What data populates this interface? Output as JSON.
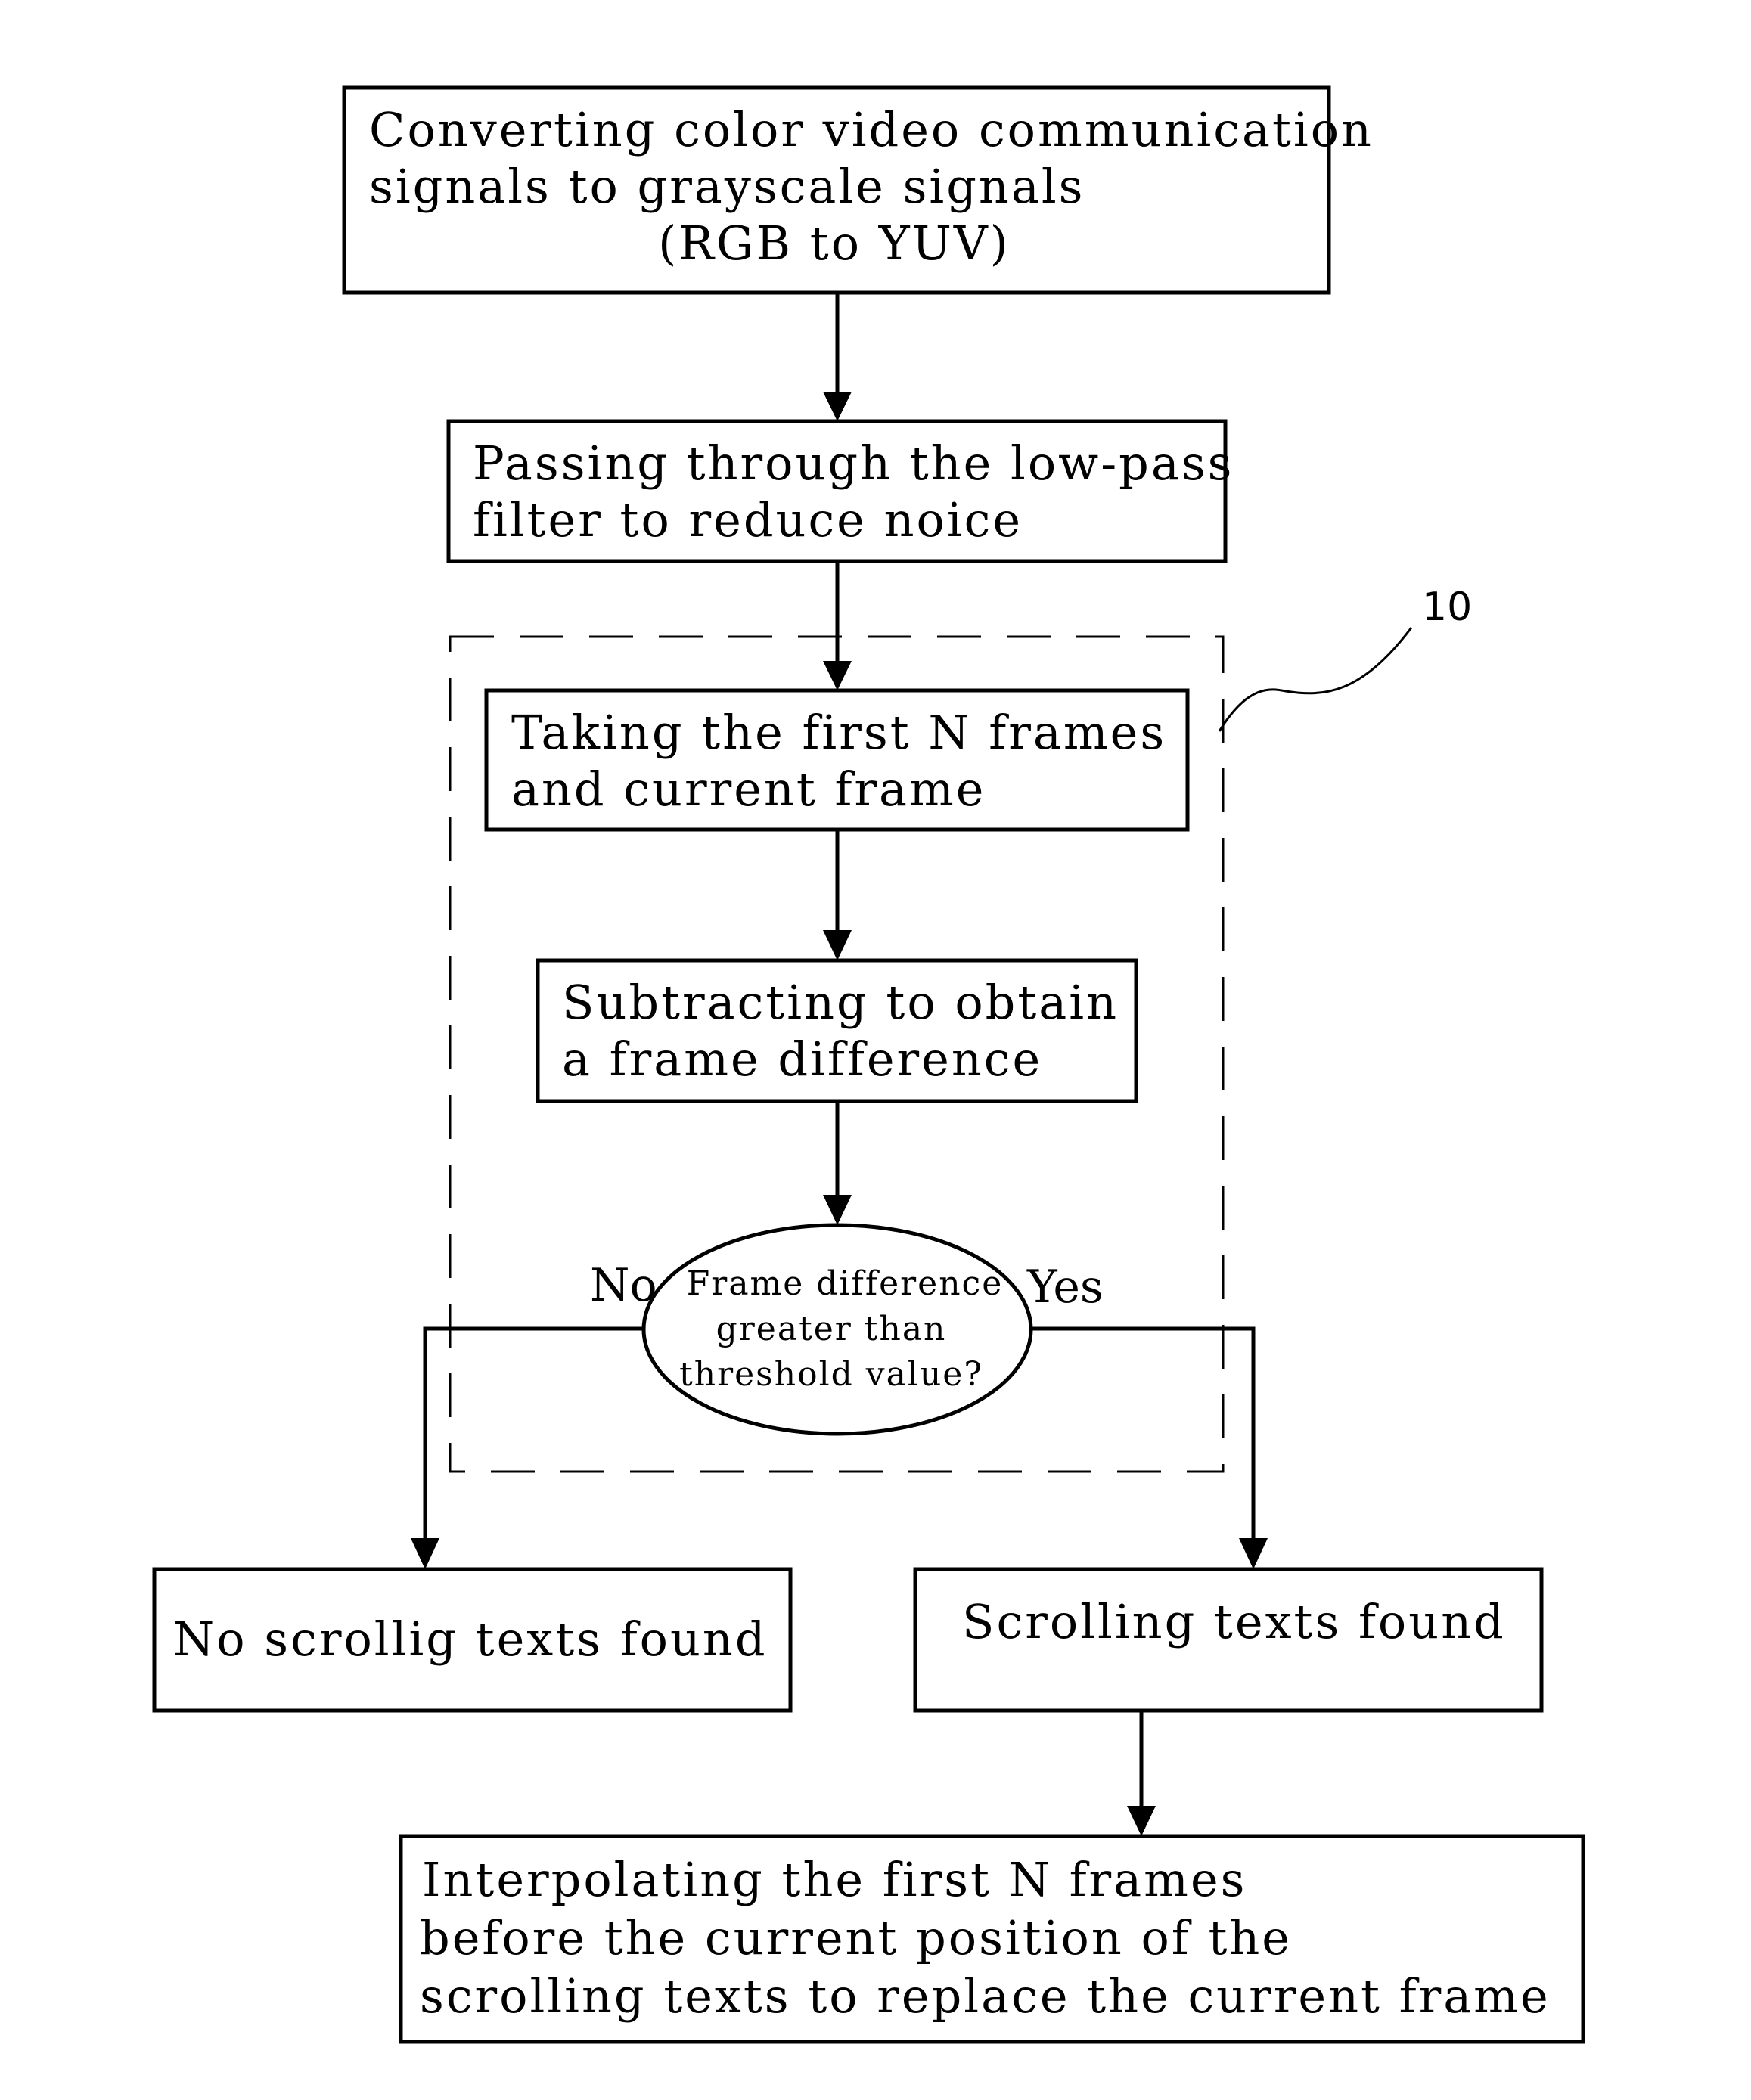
{
  "diagram": {
    "type": "flowchart",
    "steps": {
      "convert": {
        "lines": [
          "Converting color video communication",
          "signals to grayscale signals",
          "(RGB to YUV)"
        ]
      },
      "filter": {
        "lines": [
          "Passing through the low-pass",
          "filter to reduce noice"
        ]
      },
      "take_frames": {
        "lines": [
          "Taking the first N frames",
          "and current frame"
        ]
      },
      "subtract": {
        "lines": [
          "Subtracting to obtain",
          "a frame difference"
        ]
      },
      "decision": {
        "lines": [
          "Frame difference",
          "greater than",
          "threshold value?"
        ]
      },
      "no_result": {
        "lines": [
          "No scrollig texts found"
        ]
      },
      "yes_result": {
        "lines": [
          "Scrolling texts found"
        ]
      },
      "interpolate": {
        "lines": [
          "Interpolating the first N frames",
          "before the current position of the",
          "scrolling texts to replace the current frame"
        ]
      }
    },
    "branch_labels": {
      "no": "No",
      "yes": "Yes"
    },
    "reference_label": "10"
  }
}
